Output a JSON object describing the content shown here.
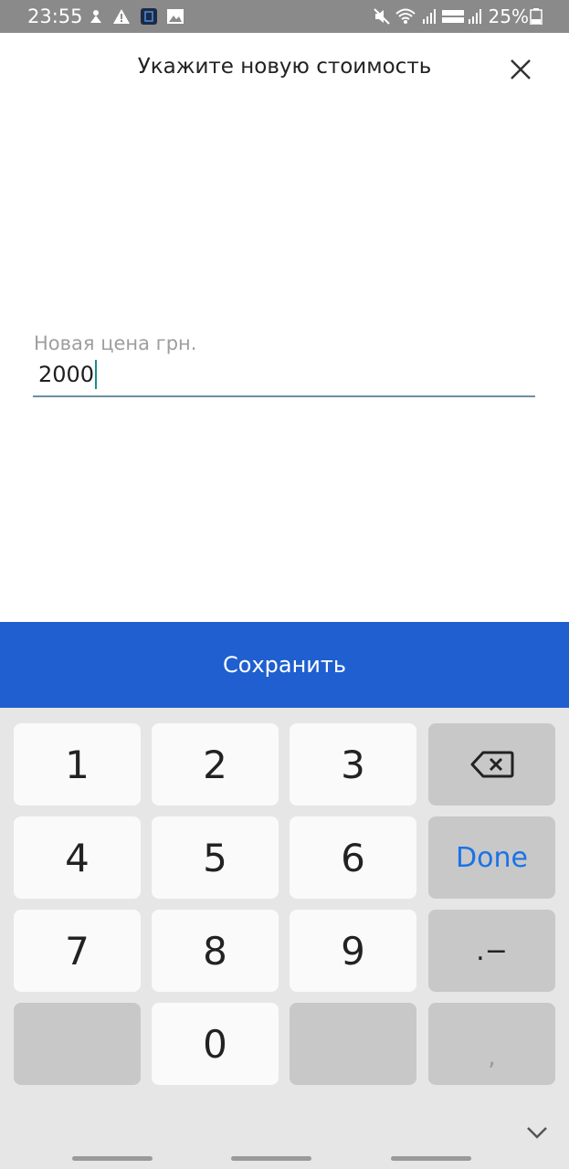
{
  "status": {
    "time": "23:55",
    "battery": "25%",
    "icons": [
      "tv-icon",
      "warning-icon",
      "app-icon",
      "image-icon",
      "mute-icon",
      "wifi-icon",
      "signal-icon",
      "volte-icon",
      "signal-icon",
      "battery-icon"
    ]
  },
  "dialog": {
    "title": "Укажите новую стоимость",
    "close_icon": "close-icon"
  },
  "price_field": {
    "label": "Новая цена грн.",
    "value": "2000"
  },
  "save_button": {
    "label": "Сохранить"
  },
  "keyboard": {
    "keys": {
      "k1": "1",
      "k2": "2",
      "k3": "3",
      "k4": "4",
      "k5": "5",
      "k6": "6",
      "k7": "7",
      "k8": "8",
      "k9": "9",
      "k0": "0",
      "done": "Done",
      "dot_dash": ".−",
      "comma": ","
    },
    "backspace_icon": "backspace-icon",
    "hide_icon": "chevron-down-icon"
  }
}
